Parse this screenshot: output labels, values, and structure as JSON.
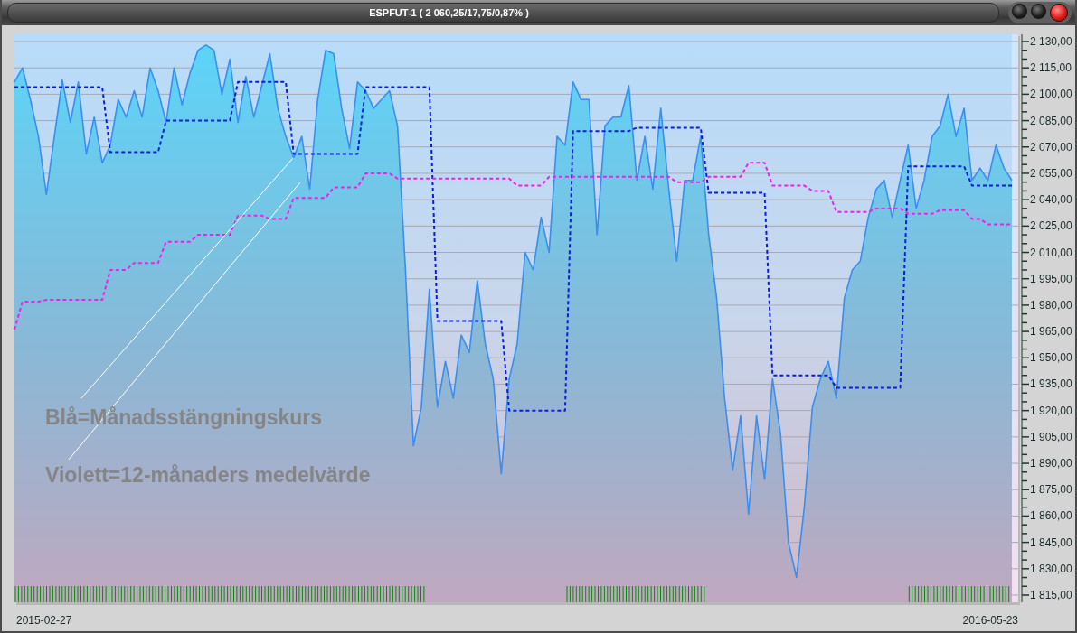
{
  "window": {
    "title": "ESPFUT-1 ( 2 060,25/17,75/0,87% )"
  },
  "chart": {
    "start_date": "2015-02-27",
    "end_date": "2016-05-23",
    "chart_data": {
      "type": "line",
      "grid": true,
      "series": [
        {
          "type": "area",
          "color": "#3a8ef0",
          "line_style": "solid",
          "values": [
            2107,
            2115,
            2097,
            2076,
            2043,
            2076,
            2108,
            2084,
            2107,
            2066,
            2087,
            2061,
            2071,
            2097,
            2087,
            2102,
            2087,
            2115,
            2102,
            2084,
            2115,
            2094,
            2112,
            2125,
            2128,
            2125,
            2100,
            2120,
            2084,
            2110,
            2087,
            2105,
            2123,
            2092,
            2076,
            2064,
            2076,
            2046,
            2097,
            2125,
            2123,
            2092,
            2069,
            2107,
            2102,
            2092,
            2097,
            2102,
            2082,
            2000,
            1900,
            1922,
            1989,
            1922,
            1948,
            1927,
            1963,
            1953,
            1994,
            1958,
            1938,
            1884,
            1938,
            1958,
            2010,
            2000,
            2030,
            2010,
            2076,
            2071,
            2107,
            2097,
            2097,
            2020,
            2082,
            2087,
            2087,
            2105,
            2051,
            2076,
            2046,
            2092,
            2046,
            2005,
            2051,
            2051,
            2076,
            2020,
            1984,
            1927,
            1886,
            1917,
            1861,
            1917,
            1881,
            1938,
            1907,
            1845,
            1825,
            1866,
            1922,
            1938,
            1948,
            1927,
            1984,
            2000,
            2005,
            2030,
            2046,
            2051,
            2030,
            2051,
            2071,
            2035,
            2051,
            2076,
            2082,
            2100,
            2076,
            2092,
            2051,
            2058,
            2051,
            2071,
            2058,
            2051
          ]
        },
        {
          "color": "#0a1ee0",
          "line_style": "dashed",
          "values": [
            2104,
            2104,
            2104,
            2104,
            2104,
            2104,
            2104,
            2104,
            2104,
            2104,
            2104,
            2104,
            2067,
            2067,
            2067,
            2067,
            2067,
            2067,
            2067,
            2085,
            2085,
            2085,
            2085,
            2085,
            2085,
            2085,
            2085,
            2085,
            2107,
            2107,
            2107,
            2107,
            2107,
            2107,
            2107,
            2066,
            2066,
            2066,
            2066,
            2066,
            2066,
            2066,
            2066,
            2066,
            2104,
            2104,
            2104,
            2104,
            2104,
            2104,
            2104,
            2104,
            2104,
            1971,
            1971,
            1971,
            1971,
            1971,
            1971,
            1971,
            1971,
            1971,
            1920,
            1920,
            1920,
            1920,
            1920,
            1920,
            1920,
            1920,
            2079,
            2079,
            2079,
            2079,
            2079,
            2079,
            2079,
            2079,
            2081,
            2081,
            2081,
            2081,
            2081,
            2081,
            2081,
            2081,
            2081,
            2044,
            2044,
            2044,
            2044,
            2044,
            2044,
            2044,
            2044,
            1940,
            1940,
            1940,
            1940,
            1940,
            1940,
            1940,
            1940,
            1933,
            1933,
            1933,
            1933,
            1933,
            1933,
            1933,
            1933,
            1933,
            2059,
            2059,
            2059,
            2059,
            2059,
            2059,
            2059,
            2059,
            2048,
            2048,
            2048,
            2048,
            2048,
            2048
          ]
        },
        {
          "color": "#f020e8",
          "line_style": "dashed",
          "values": [
            1966,
            1982,
            1982,
            1982,
            1983,
            1983,
            1983,
            1983,
            1983,
            1983,
            1983,
            1983,
            2000,
            2000,
            2000,
            2004,
            2004,
            2004,
            2004,
            2016,
            2016,
            2016,
            2016,
            2020,
            2020,
            2020,
            2020,
            2020,
            2031,
            2031,
            2031,
            2031,
            2029,
            2029,
            2029,
            2041,
            2041,
            2041,
            2041,
            2041,
            2047,
            2047,
            2047,
            2047,
            2055,
            2055,
            2055,
            2055,
            2052,
            2052,
            2052,
            2052,
            2052,
            2052,
            2052,
            2052,
            2052,
            2052,
            2052,
            2052,
            2052,
            2052,
            2052,
            2048,
            2048,
            2048,
            2048,
            2053,
            2053,
            2053,
            2053,
            2053,
            2053,
            2053,
            2053,
            2053,
            2053,
            2053,
            2053,
            2053,
            2053,
            2053,
            2053,
            2050,
            2050,
            2050,
            2050,
            2053,
            2053,
            2053,
            2053,
            2053,
            2061,
            2061,
            2061,
            2048,
            2048,
            2048,
            2048,
            2048,
            2045,
            2045,
            2045,
            2033,
            2033,
            2033,
            2033,
            2033,
            2035,
            2035,
            2035,
            2035,
            2032,
            2032,
            2032,
            2032,
            2034,
            2034,
            2034,
            2034,
            2029,
            2029,
            2026,
            2026,
            2026,
            2026
          ]
        }
      ],
      "ylim": [
        1815,
        2130
      ],
      "yticks": [
        {
          "value": 2130,
          "label": "2 130,00"
        },
        {
          "value": 2115,
          "label": "2 115,00"
        },
        {
          "value": 2100,
          "label": "2 100,00"
        },
        {
          "value": 2085,
          "label": "2 085,00"
        },
        {
          "value": 2070,
          "label": "2 070,00"
        },
        {
          "value": 2055,
          "label": "2 055,00"
        },
        {
          "value": 2040,
          "label": "2 040,00"
        },
        {
          "value": 2025,
          "label": "2 025,00"
        },
        {
          "value": 2010,
          "label": "2 010,00"
        },
        {
          "value": 1995,
          "label": "1 995,00"
        },
        {
          "value": 1980,
          "label": "1 980,00"
        },
        {
          "value": 1965,
          "label": "1 965,00"
        },
        {
          "value": 1950,
          "label": "1 950,00"
        },
        {
          "value": 1935,
          "label": "1 935,00"
        },
        {
          "value": 1920,
          "label": "1 920,00"
        },
        {
          "value": 1905,
          "label": "1 905,00"
        },
        {
          "value": 1890,
          "label": "1 890,00"
        },
        {
          "value": 1875,
          "label": "1 875,00"
        },
        {
          "value": 1860,
          "label": "1 860,00"
        },
        {
          "value": 1845,
          "label": "1 845,00"
        },
        {
          "value": 1830,
          "label": "1 830,00"
        },
        {
          "value": 1815,
          "label": "1 815,00"
        }
      ],
      "annotations": [
        {
          "text": "Blå=Månadsstängningskurs"
        },
        {
          "text": "Violett=12-månaders medelvärde"
        }
      ]
    }
  }
}
